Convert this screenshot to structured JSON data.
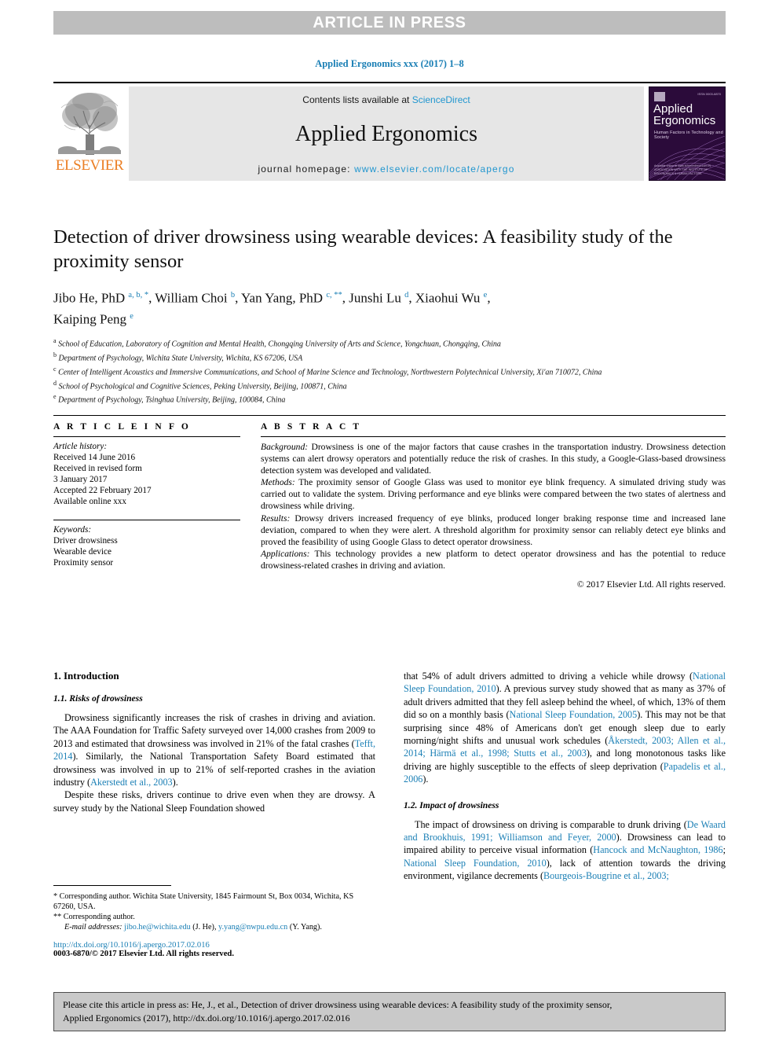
{
  "banner": {
    "text": "ARTICLE IN PRESS"
  },
  "journal_ref": "Applied Ergonomics xxx (2017) 1–8",
  "masthead": {
    "publisher": "ELSEVIER",
    "contents_prefix": "Contents lists available at ",
    "contents_link": "ScienceDirect",
    "journal_name": "Applied Ergonomics",
    "homepage_prefix": "journal homepage: ",
    "homepage_url": "www.elsevier.com/locate/apergo",
    "cover": {
      "title_line1": "Applied",
      "title_line2": "Ergonomics",
      "subtitle": "Human Factors in Technology and Society",
      "corner": "ISSN 0003-6870",
      "footer": "Available online at www.sciencedirect.com\nIN ASSOCIATION WITH THE INSTITUTE OF ERGONOMICS & HUMAN FACTORS"
    }
  },
  "article": {
    "title": "Detection of driver drowsiness using wearable devices: A feasibility study of the proximity sensor",
    "authors_line1_pre": "Jibo He, PhD ",
    "authors": "Jibo He, PhD a, b, *, William Choi b, Yan Yang, PhD c, **, Junshi Lu d, Xiaohui Wu e, Kaiping Peng e",
    "affiliations": [
      {
        "marker": "a",
        "text": "School of Education, Laboratory of Cognition and Mental Health, Chongqing University of Arts and Science, Yongchuan, Chongqing, China"
      },
      {
        "marker": "b",
        "text": "Department of Psychology, Wichita State University, Wichita, KS 67206, USA"
      },
      {
        "marker": "c",
        "text": "Center of Intelligent Acoustics and Immersive Communications, and School of Marine Science and Technology, Northwestern Polytechnical University, Xi'an 710072, China"
      },
      {
        "marker": "d",
        "text": "School of Psychological and Cognitive Sciences, Peking University, Beijing, 100871, China"
      },
      {
        "marker": "e",
        "text": "Department of Psychology, Tsinghua University, Beijing, 100084, China"
      }
    ]
  },
  "article_info": {
    "heading": "A R T I C L E   I N F O",
    "history_label": "Article history:",
    "history": [
      "Received 14 June 2016",
      "Received in revised form",
      "3 January 2017",
      "Accepted 22 February 2017",
      "Available online xxx"
    ],
    "keywords_label": "Keywords:",
    "keywords": [
      "Driver drowsiness",
      "Wearable device",
      "Proximity sensor"
    ]
  },
  "abstract": {
    "heading": "A B S T R A C T",
    "sections": [
      {
        "label": "Background:",
        "text": " Drowsiness is one of the major factors that cause crashes in the transportation industry. Drowsiness detection systems can alert drowsy operators and potentially reduce the risk of crashes. In this study, a Google-Glass-based drowsiness detection system was developed and validated."
      },
      {
        "label": "Methods:",
        "text": " The proximity sensor of Google Glass was used to monitor eye blink frequency. A simulated driving study was carried out to validate the system. Driving performance and eye blinks were compared between the two states of alertness and drowsiness while driving."
      },
      {
        "label": "Results:",
        "text": " Drowsy drivers increased frequency of eye blinks, produced longer braking response time and increased lane deviation, compared to when they were alert. A threshold algorithm for proximity sensor can reliably detect eye blinks and proved the feasibility of using Google Glass to detect operator drowsiness."
      },
      {
        "label": "Applications:",
        "text": " This technology provides a new platform to detect operator drowsiness and has the potential to reduce drowsiness-related crashes in driving and aviation."
      }
    ],
    "copyright": "© 2017 Elsevier Ltd. All rights reserved."
  },
  "body": {
    "section_1": "1. Introduction",
    "section_1_1": "1.1. Risks of drowsiness",
    "section_1_2": "1.2. Impact of drowsiness",
    "left_p1_a": "Drowsiness significantly increases the risk of crashes in driving and aviation. The AAA Foundation for Traffic Safety surveyed over 14,000 crashes from 2009 to 2013 and estimated that drowsiness was involved in 21% of the fatal crashes (",
    "left_p1_cite1": "Tefft, 2014",
    "left_p1_b": "). Similarly, the National Transportation Safety Board estimated that drowsiness was involved in up to 21% of self-reported crashes in the aviation industry (",
    "left_p1_cite2": "Akerstedt et al., 2003",
    "left_p1_c": ").",
    "left_p2": "Despite these risks, drivers continue to drive even when they are drowsy. A survey study by the National Sleep Foundation showed",
    "right_p1_a": "that 54% of adult drivers admitted to driving a vehicle while drowsy (",
    "right_p1_cite1": "National Sleep Foundation, 2010",
    "right_p1_b": "). A previous survey study showed that as many as 37% of adult drivers admitted that they fell asleep behind the wheel, of which, 13% of them did so on a monthly basis (",
    "right_p1_cite2": "National Sleep Foundation, 2005",
    "right_p1_c": "). This may not be that surprising since 48% of Americans don't get enough sleep due to early morning/night shifts and unusual work schedules (",
    "right_p1_cite3": "Åkerstedt, 2003; Allen et al., 2014; Härmä et al., 1998; Stutts et al., 2003",
    "right_p1_d": "), and long monotonous tasks like driving are highly susceptible to the effects of sleep deprivation (",
    "right_p1_cite4": "Papadelis et al., 2006",
    "right_p1_e": ").",
    "right_p2_a": "The impact of drowsiness on driving is comparable to drunk driving (",
    "right_p2_cite1": "De Waard and Brookhuis, 1991; Williamson and Feyer, 2000",
    "right_p2_b": "). Drowsiness can lead to impaired ability to perceive visual information (",
    "right_p2_cite2": "Hancock and McNaughton, 1986",
    "right_p2_c": "; ",
    "right_p2_cite3": "National Sleep Foundation, 2010",
    "right_p2_d": "), lack of attention towards the driving environment, vigilance decrements (",
    "right_p2_cite4": "Bourgeois-Bougrine et al., 2003;"
  },
  "footnotes": {
    "fn1": "* Corresponding author. Wichita State University, 1845 Fairmount St, Box 0034, Wichita, KS 67260, USA.",
    "fn2": "** Corresponding author.",
    "email_label": "E-mail addresses:",
    "email1": "jibo.he@wichita.edu",
    "email1_owner": "(J. He),",
    "email2": "y.yang@nwpu.edu.cn",
    "email2_owner": "(Y. Yang).",
    "doi": "http://dx.doi.org/10.1016/j.apergo.2017.02.016",
    "issn": "0003-6870/© 2017 Elsevier Ltd. All rights reserved."
  },
  "citation_box": {
    "line1": "Please cite this article in press as: He, J., et al., Detection of driver drowsiness using wearable devices: A feasibility study of the proximity sensor,",
    "line2": "Applied Ergonomics (2017), http://dx.doi.org/10.1016/j.apergo.2017.02.016"
  },
  "colors": {
    "link_blue": "#1a7fb5",
    "sciencedirect_blue": "#2196cf",
    "banner_gray": "#bdbdbd",
    "masthead_gray": "#e6e6e6",
    "elsevier_orange": "#eb7e23",
    "cover_purple": "#2b0b3a",
    "cite_box_gray": "#c9c9c9"
  }
}
